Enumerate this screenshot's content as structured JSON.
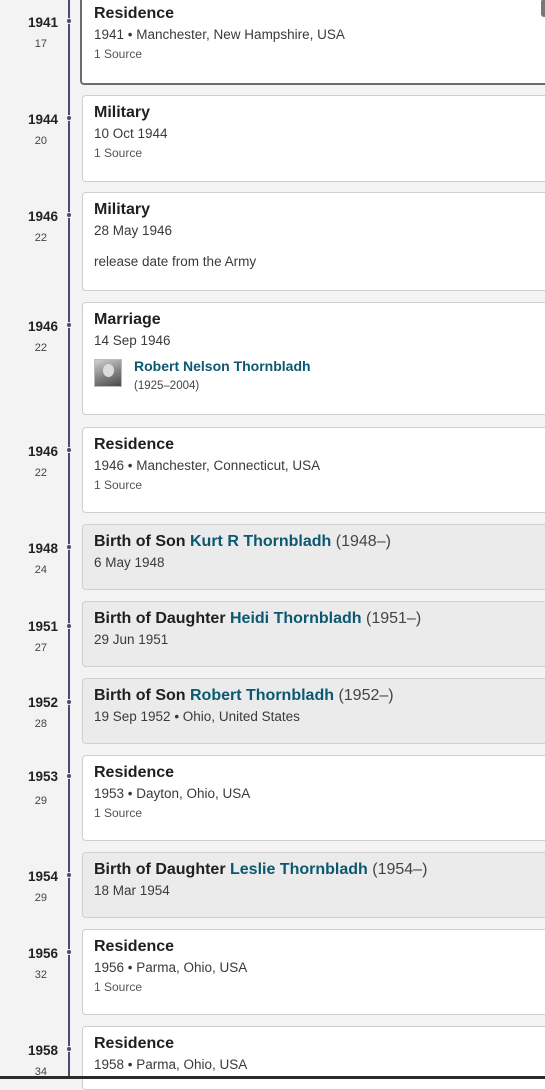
{
  "events": [
    {
      "year": "1941",
      "age": "17",
      "type": "Residence",
      "detail": "1941 • Manchester, New Hampshire, USA",
      "sources": "1 Source",
      "selected": true
    },
    {
      "year": "1944",
      "age": "20",
      "type": "Military",
      "detail": "10 Oct 1944",
      "sources": "1 Source"
    },
    {
      "year": "1946",
      "age": "22",
      "type": "Military",
      "detail": "28 May 1946",
      "note": "release date from the Army"
    },
    {
      "year": "1946",
      "age": "22",
      "type": "Marriage",
      "detail": "14 Sep 1946",
      "spouse": {
        "name": "Robert Nelson Thornbladh",
        "dates": "(1925–2004)"
      }
    },
    {
      "year": "1946",
      "age": "22",
      "type": "Residence",
      "detail": "1946 • Manchester, Connecticut, USA",
      "sources": "1 Source"
    },
    {
      "year": "1948",
      "age": "24",
      "type": "Birth of Son",
      "person": "Kurt R Thornbladh",
      "person_dates": "(1948–)",
      "detail": "6 May 1948",
      "relative": true
    },
    {
      "year": "1951",
      "age": "27",
      "type": "Birth of Daughter",
      "person": "Heidi Thornbladh",
      "person_dates": "(1951–)",
      "detail": "29 Jun 1951",
      "relative": true
    },
    {
      "year": "1952",
      "age": "28",
      "type": "Birth of Son",
      "person": "Robert Thornbladh",
      "person_dates": "(1952–)",
      "detail": "19 Sep 1952 • Ohio, United States",
      "relative": true
    },
    {
      "year": "1953",
      "age": "29",
      "type": "Residence",
      "detail": "1953 • Dayton, Ohio, USA",
      "sources": "1 Source"
    },
    {
      "year": "1954",
      "age": "29",
      "type": "Birth of Daughter",
      "person": "Leslie Thornbladh",
      "person_dates": "(1954–)",
      "detail": "18 Mar 1954",
      "relative": true
    },
    {
      "year": "1956",
      "age": "32",
      "type": "Residence",
      "detail": "1956 • Parma, Ohio, USA",
      "sources": "1 Source"
    },
    {
      "year": "1958",
      "age": "34",
      "type": "Residence",
      "detail": "1958 • Parma, Ohio, USA"
    }
  ]
}
